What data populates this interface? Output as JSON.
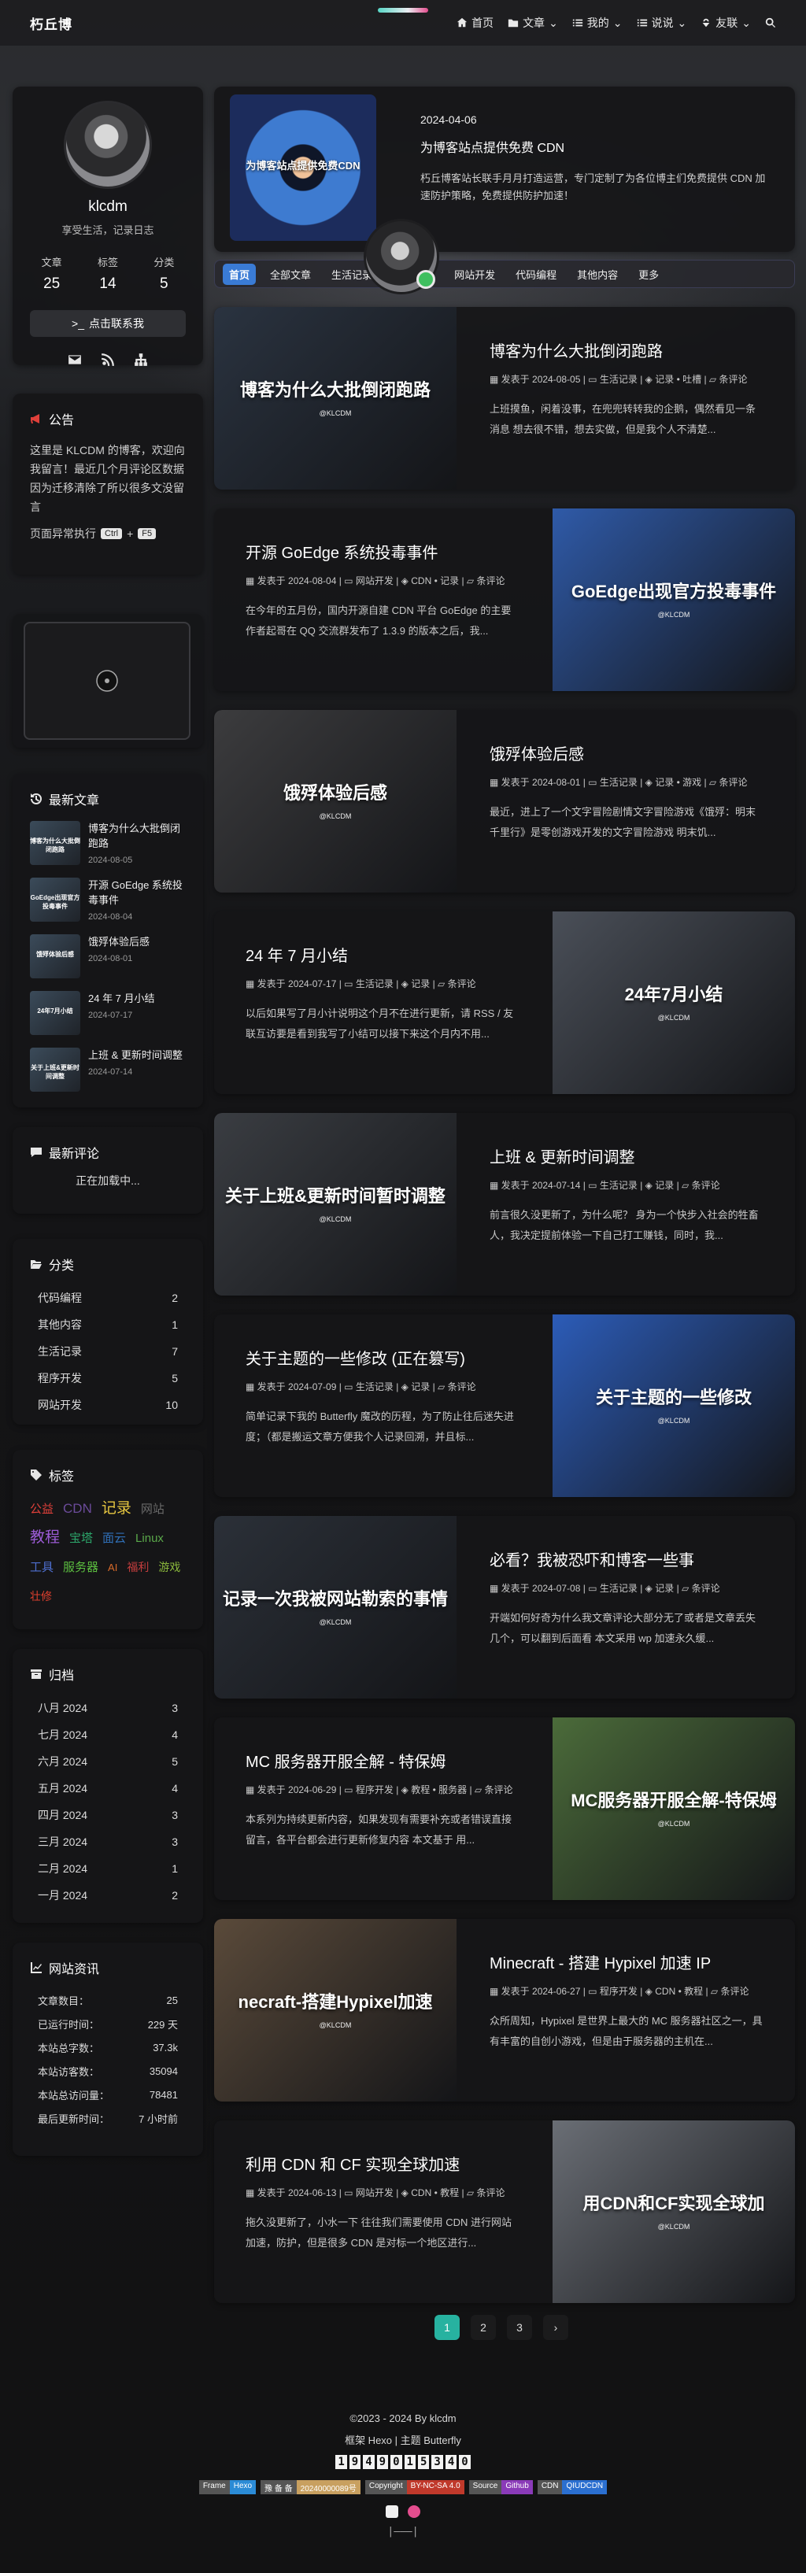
{
  "nav": {
    "brand": "朽丘博",
    "items": [
      {
        "label": "首页",
        "icon": "home-icon"
      },
      {
        "label": "文章",
        "icon": "folder-icon"
      },
      {
        "label": "我的",
        "icon": "list-icon"
      },
      {
        "label": "说说",
        "icon": "list-icon"
      },
      {
        "label": "友联",
        "icon": "link-icon"
      }
    ]
  },
  "profile": {
    "name": "klcdm",
    "desc": "享受生活，记录日志",
    "stats": [
      {
        "label": "文章",
        "value": "25"
      },
      {
        "label": "标签",
        "value": "14"
      },
      {
        "label": "分类",
        "value": "5"
      }
    ],
    "follow": "点击联系我"
  },
  "notice": {
    "title": "公告",
    "text": "这里是 KLCDM 的博客，欢迎向我留言！最近几个月评论区数据因为迁移清除了所以很多文没留言",
    "shortcut_prefix": "页面异常执行",
    "key1": "Ctrl",
    "plus": "+",
    "key2": "F5"
  },
  "recent": {
    "title": "最新文章",
    "items": [
      {
        "title": "博客为什么大批倒闭跑路",
        "date": "2024-08-05",
        "thumb": "博客为什么大批倒闭跑路"
      },
      {
        "title": "开源 GoEdge 系统投毒事件",
        "date": "2024-08-04",
        "thumb": "GoEdge出现官方投毒事件"
      },
      {
        "title": "饿殍体验后感",
        "date": "2024-08-01",
        "thumb": "饿殍体验后感"
      },
      {
        "title": "24 年 7 月小结",
        "date": "2024-07-17",
        "thumb": "24年7月小结"
      },
      {
        "title": "上班 & 更新时间调整",
        "date": "2024-07-14",
        "thumb": "关于上班&更新时间调整"
      }
    ]
  },
  "comments": {
    "title": "最新评论",
    "loading": "正在加载中..."
  },
  "categories": {
    "title": "分类",
    "items": [
      {
        "name": "代码编程",
        "count": "2"
      },
      {
        "name": "其他内容",
        "count": "1"
      },
      {
        "name": "生活记录",
        "count": "7"
      },
      {
        "name": "程序开发",
        "count": "5"
      },
      {
        "name": "网站开发",
        "count": "10"
      }
    ]
  },
  "tags": {
    "title": "标签",
    "items": [
      {
        "name": "公益",
        "color": "#e0403a",
        "size": 15
      },
      {
        "name": "CDN",
        "color": "#6b4b9a",
        "size": 17
      },
      {
        "name": "记录",
        "color": "#e6c640",
        "size": 19
      },
      {
        "name": "网站",
        "color": "#6a6a6a",
        "size": 15
      },
      {
        "name": "教程",
        "color": "#9c5bd6",
        "size": 19
      },
      {
        "name": "宝塔",
        "color": "#2ca56a",
        "size": 15
      },
      {
        "name": "面云",
        "color": "#3070b8",
        "size": 15
      },
      {
        "name": "Linux",
        "color": "#5aa84a",
        "size": 15
      },
      {
        "name": "工具",
        "color": "#4e6fd0",
        "size": 15
      },
      {
        "name": "服务器",
        "color": "#5cbf40",
        "size": 15
      },
      {
        "name": "AI",
        "color": "#d86a2a",
        "size": 13
      },
      {
        "name": "福利",
        "color": "#c43d3d",
        "size": 14
      },
      {
        "name": "游戏",
        "color": "#8bb93c",
        "size": 14
      },
      {
        "name": "壮修",
        "color": "#e0402e",
        "size": 14
      }
    ]
  },
  "archives": {
    "title": "归档",
    "items": [
      {
        "name": "八月 2024",
        "count": "3"
      },
      {
        "name": "七月 2024",
        "count": "4"
      },
      {
        "name": "六月 2024",
        "count": "5"
      },
      {
        "name": "五月 2024",
        "count": "4"
      },
      {
        "name": "四月 2024",
        "count": "3"
      },
      {
        "name": "三月 2024",
        "count": "3"
      },
      {
        "name": "二月 2024",
        "count": "1"
      },
      {
        "name": "一月 2024",
        "count": "2"
      }
    ]
  },
  "site": {
    "title": "网站资讯",
    "items": [
      {
        "name": "文章数目：",
        "count": "25"
      },
      {
        "name": "已运行时间：",
        "count": "229 天"
      },
      {
        "name": "本站总字数：",
        "count": "37.3k"
      },
      {
        "name": "本站访客数：",
        "count": "35094"
      },
      {
        "name": "本站总访问量：",
        "count": "78481"
      },
      {
        "name": "最后更新时间：",
        "count": "7 小时前"
      }
    ]
  },
  "top_post": {
    "date": "2024-04-06",
    "title": "为博客站点提供免费 CDN",
    "excerpt": "朽丘博客站长联手月月打造运营，专门定制了为各位博主们免费提供 CDN 加速防护策略，免费提供防护加速！",
    "image_caption": "为博客站点提供免费CDN"
  },
  "tabs": [
    "首页",
    "全部文章",
    "生活记录",
    "程序开发",
    "网站开发",
    "代码编程",
    "其他内容",
    "更多"
  ],
  "posts": [
    {
      "title": "博客为什么大批倒闭跑路",
      "date": "2024-08-05",
      "category": "生活记录",
      "tags": "记录 • 吐槽",
      "comments": "条评论",
      "excerpt": "上班摸鱼，闲着没事，在兜兜转转我的企鹅，偶然看见一条消息 想去很不错，想去实做，但是我个人不清楚...",
      "img": "博客为什么大批倒闭跑路",
      "img_bg": "#2a3340"
    },
    {
      "title": "开源 GoEdge 系统投毒事件",
      "date": "2024-08-04",
      "category": "网站开发",
      "tags": "CDN • 记录",
      "comments": "条评论",
      "excerpt": "在今年的五月份，国内开源自建 CDN 平台 GoEdge 的主要作者起哥在 QQ 交流群发布了 1.3.9 的版本之后，我...",
      "img": "GoEdge出现官方投毒事件",
      "img_bg": "#2f5aa8"
    },
    {
      "title": "饿殍体验后感",
      "date": "2024-08-01",
      "category": "生活记录",
      "tags": "记录 • 游戏",
      "comments": "条评论",
      "excerpt": "最近，进上了一个文字冒险剧情文字冒险游戏《饿殍：明末千里行》是零创游戏开发的文字冒险游戏 明末饥...",
      "img": "饿殍体验后感",
      "img_bg": "#3c3c3e"
    },
    {
      "title": "24 年 7 月小结",
      "date": "2024-07-17",
      "category": "生活记录",
      "tags": "记录",
      "comments": "条评论",
      "excerpt": "以后如果写了月小计说明这个月不在进行更新，请 RSS / 友联互访要是看到我写了小结可以接下来这个月内不用...",
      "img": "24年7月小结",
      "img_bg": "#4a4f58"
    },
    {
      "title": "上班 & 更新时间调整",
      "date": "2024-07-14",
      "category": "生活记录",
      "tags": "记录",
      "comments": "条评论",
      "excerpt": "前言很久没更新了，为什么呢？ 身为一个快步入社会的牲畜人，我决定提前体验一下自己打工赚钱，同时，我...",
      "img": "关于上班&更新时间暂时调整",
      "img_bg": "#3a3d42"
    },
    {
      "title": "关于主题的一些修改 (正在篡写)",
      "date": "2024-07-09",
      "category": "生活记录",
      "tags": "记录",
      "comments": "条评论",
      "excerpt": "简单记录下我的 Butterfly 魔改的历程，为了防止往后迷失进度；（都是搬运文章方便我个人记录回溯，并且标...",
      "img": "关于主题的一些修改",
      "img_bg": "#2c5cb8"
    },
    {
      "title": "必看？我被恐吓和博客一些事",
      "date": "2024-07-08",
      "category": "生活记录",
      "tags": "记录",
      "comments": "条评论",
      "excerpt": "开端如何好奇为什么我文章评论大部分无了或者是文章丢失几个，可以翻到后面看 本文采用 wp 加速永久缓...",
      "img": "记录一次我被网站勒索的事情",
      "img_bg": "#2b3038"
    },
    {
      "title": "MC 服务器开服全解 - 特保姆",
      "date": "2024-06-29",
      "category": "程序开发",
      "tags": "教程 • 服务器",
      "comments": "条评论",
      "excerpt": "本系列为持续更新内容，如果发现有需要补充或者错误直接留言，各平台都会进行更新修复内容 本文基于 用...",
      "img": "MC服务器开服全解-特保姆",
      "img_bg": "#4b6b3a"
    },
    {
      "title": "Minecraft - 搭建 Hypixel 加速 IP",
      "date": "2024-06-27",
      "category": "程序开发",
      "tags": "CDN • 教程",
      "comments": "条评论",
      "excerpt": "众所周知，Hypixel 是世界上最大的 MC 服务器社区之一，具有丰富的自创小游戏，但是由于服务器的主机在...",
      "img": "necraft-搭建Hypixel加速",
      "img_bg": "#5a4a3a"
    },
    {
      "title": "利用 CDN 和 CF 实现全球加速",
      "date": "2024-06-13",
      "category": "网站开发",
      "tags": "CDN • 教程",
      "comments": "条评论",
      "excerpt": "拖久没更新了，小水一下 往往我们需要使用 CDN 进行网站加速，防护，但是很多 CDN 是对标一个地区进行...",
      "img": "用CDN和CF实现全球加",
      "img_bg": "#6a6e75"
    }
  ],
  "img_logo": "@KLCDM",
  "pager": [
    "1",
    "2",
    "3",
    "›"
  ],
  "footer": {
    "copyright": "©2023 - 2024 By klcdm",
    "framework": "框架 Hexo | 主题 Butterfly",
    "counter": [
      "1",
      "9",
      "4",
      "9",
      "0",
      "1",
      "5",
      "3",
      "4",
      "0"
    ],
    "badges": [
      {
        "l": "Frame",
        "r": "Hexo",
        "c": "#2b8bd6"
      },
      {
        "l": "豫 备 备",
        "r": "20240000089号",
        "c": "#c8a060"
      },
      {
        "l": "Copyright",
        "r": "BY-NC-SA 4.0",
        "c": "#c0392b"
      },
      {
        "l": "Source",
        "r": "Github",
        "c": "#8a3ab8"
      },
      {
        "l": "CDN",
        "r": "QIUDCDN",
        "c": "#2b6fd0"
      }
    ],
    "line": "|———|"
  }
}
